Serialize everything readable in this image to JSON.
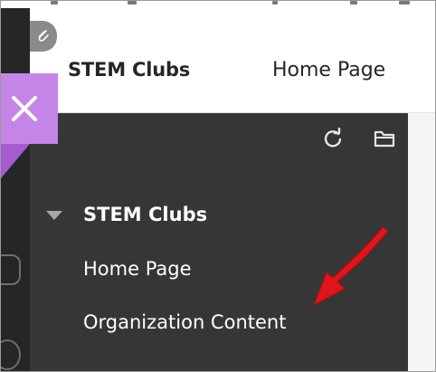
{
  "header": {
    "course_title": "STEM Clubs",
    "breadcrumb": "Home Page"
  },
  "course_menu": {
    "header": "STEM Clubs",
    "items": [
      {
        "label": "Home Page"
      },
      {
        "label": "Organization Content"
      }
    ]
  },
  "icons": {
    "close": "close-icon",
    "refresh": "refresh-icon",
    "folder": "folder-icon",
    "clip": "paperclip-icon",
    "annotation": "red-arrow-annotation"
  },
  "colors": {
    "panel": "#363636",
    "rail": "#262626",
    "close_tab": "#c585e6",
    "annotation": "#e0141a",
    "text_light": "#ffffff",
    "text_dark": "#262626"
  }
}
